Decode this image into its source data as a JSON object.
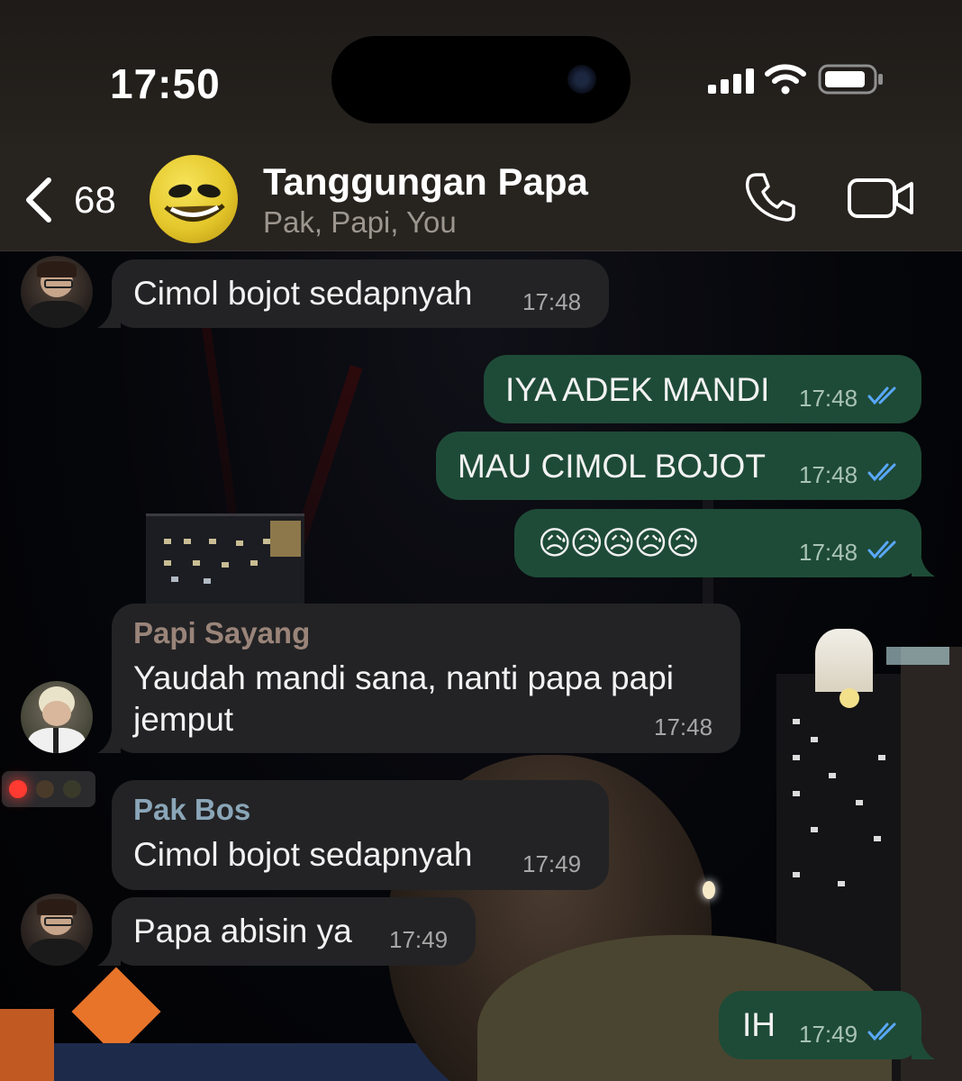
{
  "status_bar": {
    "time": "17:50",
    "icons": [
      "cellular-signal-icon",
      "wifi-icon",
      "battery-icon"
    ]
  },
  "header": {
    "back_count": "68",
    "title": "Tanggungan Papa",
    "subtitle": "Pak, Papi, You",
    "icons": [
      "chevron-left-icon",
      "phone-icon",
      "video-camera-icon"
    ]
  },
  "colors": {
    "incoming_bubble": "#232325",
    "outgoing_bubble": "#1e4b37",
    "read_ticks": "#5aa8ff",
    "sender_papi": "#9a8479",
    "sender_pakbos": "#8aa6b8"
  },
  "messages": [
    {
      "direction": "in",
      "sender": "",
      "text": "Cimol bojot sedapnyah",
      "time": "17:48"
    },
    {
      "direction": "out",
      "text": "IYA ADEK MANDI",
      "time": "17:48"
    },
    {
      "direction": "out",
      "text": "MAU CIMOL BOJOT",
      "time": "17:48"
    },
    {
      "direction": "out",
      "text": "😥😥😥😥😥",
      "time": "17:48"
    },
    {
      "direction": "in",
      "sender": "Papi Sayang",
      "text_line1": "Yaudah mandi sana, nanti papa papi",
      "text_line2": "jemput",
      "time": "17:48"
    },
    {
      "direction": "in",
      "sender": "Pak Bos",
      "text": "Cimol bojot sedapnyah",
      "time": "17:49"
    },
    {
      "direction": "in",
      "sender": "",
      "text": "Papa abisin ya",
      "time": "17:49"
    },
    {
      "direction": "out",
      "text": "IH",
      "time": "17:49"
    }
  ]
}
